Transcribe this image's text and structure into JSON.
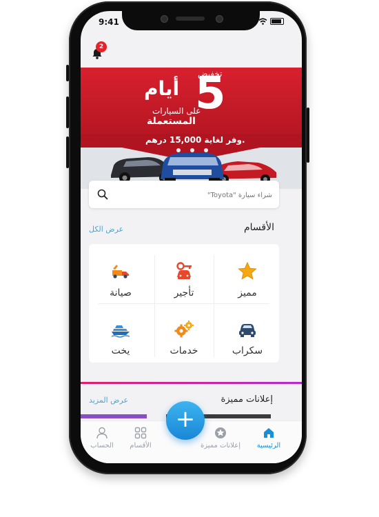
{
  "status_bar": {
    "time": "9:41"
  },
  "notifications": {
    "count": "2"
  },
  "banner": {
    "number": "5",
    "discount": "تخفيض",
    "days": "أيام",
    "line1": "على السيارات",
    "line2": "المستعملة",
    "save": "وفر لغاية 15,000 درهم."
  },
  "search": {
    "placeholder": "شراء سيارة \"Toyota\""
  },
  "categories": {
    "title": "الأقسام",
    "see_all": "عرض الكل",
    "items": [
      {
        "label": "مميز",
        "icon": "star-icon"
      },
      {
        "label": "تأجير",
        "icon": "car-key-icon"
      },
      {
        "label": "صيانة",
        "icon": "repair-truck-icon"
      },
      {
        "label": "سكراب",
        "icon": "car-icon"
      },
      {
        "label": "خدمات",
        "icon": "gears-icon"
      },
      {
        "label": "يخت",
        "icon": "yacht-icon"
      }
    ]
  },
  "featured": {
    "title": "إعلانات مميزة",
    "see_more": "عرض المزيد"
  },
  "bottom_nav": {
    "items": [
      {
        "label": "الرئيسية",
        "icon": "home-icon",
        "active": true
      },
      {
        "label": "إعلانات مميزة",
        "icon": "star-circle-icon",
        "active": false
      },
      {
        "label": "الأقسام",
        "icon": "grid-icon",
        "active": false
      },
      {
        "label": "الحساب",
        "icon": "user-icon",
        "active": false
      }
    ],
    "fab": "+"
  },
  "colors": {
    "accent": "#1a8fd6",
    "brand_red": "#d8202e",
    "icon_orange": "#f08a1c",
    "icon_navy": "#2d4a6b",
    "link": "#46a8d8"
  }
}
